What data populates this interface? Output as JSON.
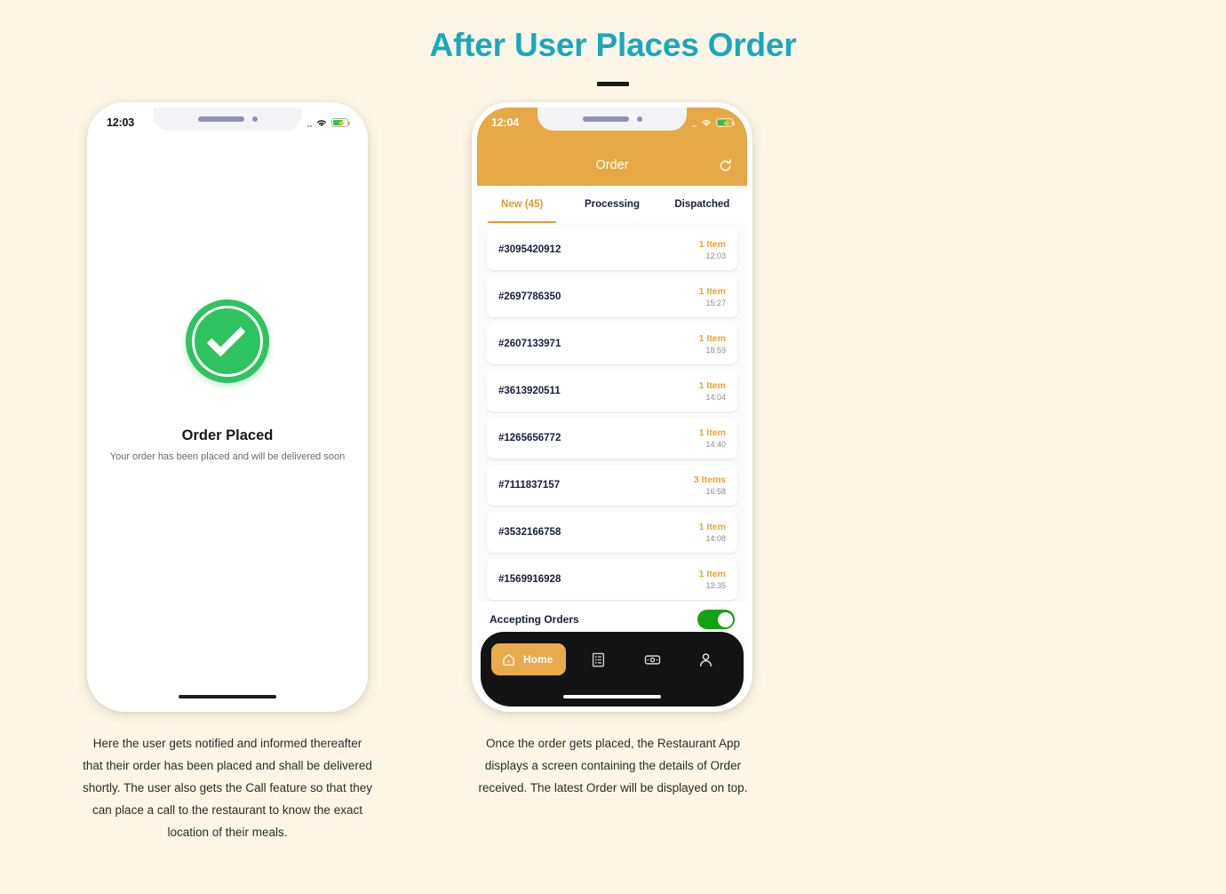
{
  "header": {
    "title": "After User Places Order"
  },
  "colors": {
    "page_background": "#FDF6E6",
    "title_teal": "#18A8BD",
    "brand_orange": "#E6A945",
    "accent_orange": "#E8A33A",
    "success_green": "#2EC35E",
    "toggle_green": "#13A213",
    "navbar_dark": "#131313"
  },
  "phone_left": {
    "status_bar": {
      "time": "12:03",
      "signal_icon": "signal-dots-icon",
      "wifi_icon": "wifi-icon",
      "battery_icon": "battery-charging-icon"
    },
    "success": {
      "check_icon": "check-circle-icon",
      "title": "Order Placed",
      "subtitle": "Your order has been placed and will be delivered soon"
    },
    "home_indicator": "home-indicator"
  },
  "phone_right": {
    "status_bar": {
      "time": "12:04",
      "signal_icon": "signal-dots-icon",
      "wifi_icon": "wifi-icon",
      "battery_icon": "battery-charging-icon"
    },
    "app_header": {
      "title": "Order",
      "refresh_icon": "refresh-icon"
    },
    "tabs": [
      {
        "label": "New (45)",
        "active": true
      },
      {
        "label": "Processing",
        "active": false
      },
      {
        "label": "Dispatched",
        "active": false
      }
    ],
    "orders": [
      {
        "id": "#3095420912",
        "items": "1 Item",
        "time": "12:03"
      },
      {
        "id": "#2697786350",
        "items": "1 Item",
        "time": "15:27"
      },
      {
        "id": "#2607133971",
        "items": "1 Item",
        "time": "18:59"
      },
      {
        "id": "#3613920511",
        "items": "1 Item",
        "time": "14:04"
      },
      {
        "id": "#1265656772",
        "items": "1 Item",
        "time": "14:40"
      },
      {
        "id": "#7111837157",
        "items": "3 Items",
        "time": "16:58"
      },
      {
        "id": "#3532166758",
        "items": "1 Item",
        "time": "14:08"
      },
      {
        "id": "#1569916928",
        "items": "1 Item",
        "time": "13:35"
      }
    ],
    "accepting": {
      "label": "Accepting Orders",
      "toggle_state": "on"
    },
    "tabbar": {
      "home_label": "Home",
      "items": [
        {
          "icon": "home-icon",
          "label": "Home",
          "active": true
        },
        {
          "icon": "receipt-list-icon",
          "label": "",
          "active": false
        },
        {
          "icon": "cash-banknote-icon",
          "label": "",
          "active": false
        },
        {
          "icon": "person-icon",
          "label": "",
          "active": false
        }
      ]
    },
    "home_indicator": "home-indicator"
  },
  "captions": {
    "left": "Here the user gets notified and informed thereafter that their order has been placed and shall be delivered shortly. The user also gets the Call feature so that they can place a call to the restaurant to know the exact location of their meals.",
    "right": "Once the order gets placed, the Restaurant App displays a screen containing the details of Order received. The latest Order will be displayed on top."
  }
}
